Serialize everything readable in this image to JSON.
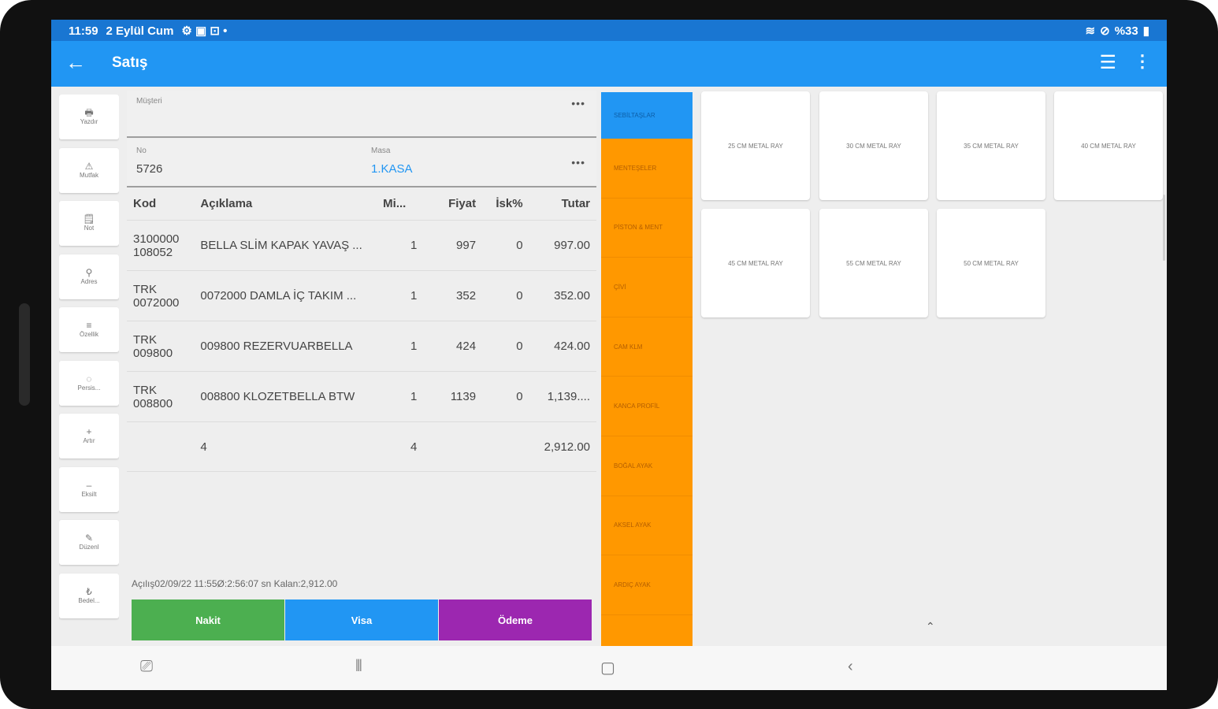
{
  "status": {
    "time": "11:59",
    "date": "2 Eylül Cum",
    "battery": "%33"
  },
  "appbar": {
    "title": "Satış"
  },
  "tools": [
    {
      "icon": "printer-icon",
      "glyph": "🖶",
      "label": "Yazdır"
    },
    {
      "icon": "kitchen-icon",
      "glyph": "⚠",
      "label": "Mutfak"
    },
    {
      "icon": "note-icon",
      "glyph": "🗒",
      "label": "Not"
    },
    {
      "icon": "location-icon",
      "glyph": "⚲",
      "label": "Adres"
    },
    {
      "icon": "list-icon",
      "glyph": "≡",
      "label": "Özellik"
    },
    {
      "icon": "refresh-icon",
      "glyph": "◌",
      "label": "Persis..."
    },
    {
      "icon": "plus-icon",
      "glyph": "+",
      "label": "Artır"
    },
    {
      "icon": "minus-icon",
      "glyph": "–",
      "label": "Eksilt"
    },
    {
      "icon": "edit-icon",
      "glyph": "✎",
      "label": "Düzenl"
    },
    {
      "icon": "currency-icon",
      "glyph": "₺",
      "label": "Bedel..."
    }
  ],
  "form": {
    "customer_label": "Müşteri",
    "customer_value": "",
    "no_label": "No",
    "no_value": "5726",
    "masa_label": "Masa",
    "masa_value": "1.KASA"
  },
  "table": {
    "headers": [
      "Kod",
      "Açıklama",
      "Mi...",
      "Fiyat",
      "İsk%",
      "Tutar"
    ],
    "rows": [
      {
        "kod": "3100000 108052",
        "aciklama": "BELLA SLİM KAPAK YAVAŞ ...",
        "miktar": "1",
        "fiyat": "997",
        "isk": "0",
        "tutar": "997.00"
      },
      {
        "kod": "TRK 0072000",
        "aciklama": "0072000 DAMLA İÇ TAKIM ...",
        "miktar": "1",
        "fiyat": "352",
        "isk": "0",
        "tutar": "352.00"
      },
      {
        "kod": "TRK 009800",
        "aciklama": "009800 REZERVUARBELLA",
        "miktar": "1",
        "fiyat": "424",
        "isk": "0",
        "tutar": "424.00"
      },
      {
        "kod": "TRK 008800",
        "aciklama": "008800 KLOZETBELLA BTW",
        "miktar": "1",
        "fiyat": "1139",
        "isk": "0",
        "tutar": "1,139...."
      }
    ],
    "total": {
      "count": "4",
      "qty": "4",
      "amount": "2,912.00"
    }
  },
  "info": "Açılış02/09/22 11:55Ø:2:56:07 sn Kalan:2,912.00",
  "payments": {
    "nakit": "Nakit",
    "visa": "Visa",
    "odeme": "Ödeme"
  },
  "categories": [
    "SEBİLTAŞLAR",
    "MENTEŞELER",
    "PİSTON & MENT",
    "ÇİVİ",
    "CAM KLM",
    "KANCA PROFİL",
    "BOĞAL AYAK",
    "AKSEL AYAK",
    "ARDIÇ AYAK"
  ],
  "products": [
    "25 CM METAL RAY",
    "30 CM METAL RAY",
    "35 CM METAL RAY",
    "40 CM METAL RAY",
    "45 CM METAL RAY",
    "55 CM METAL RAY",
    "50 CM METAL RAY"
  ],
  "colors": {
    "primary": "#2196f3",
    "statusbar": "#1976d2",
    "nakit": "#4caf50",
    "visa": "#2196f3",
    "odeme": "#9c27b0",
    "category": "#ff9800"
  }
}
